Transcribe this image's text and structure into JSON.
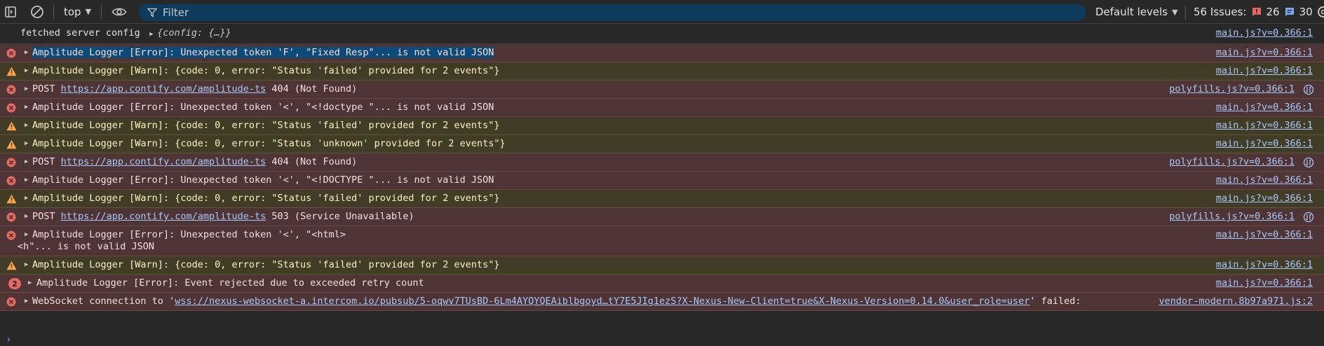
{
  "toolbar": {
    "context_label": "top",
    "filter_placeholder": "Filter",
    "levels_label": "Default levels",
    "issues_label": "56 Issues:",
    "issues_errors": "26",
    "issues_messages": "30"
  },
  "rows": [
    {
      "type": "info",
      "text": "fetched server config",
      "object": "{config: {…}}",
      "source": "main.js?v=0.366:1"
    },
    {
      "type": "error",
      "text": "Amplitude Logger [Error]: Unexpected token 'F', \"Fixed Resp\"... is not valid JSON",
      "source": "main.js?v=0.366:1"
    },
    {
      "type": "warn",
      "text": "Amplitude Logger [Warn]: {code: 0, error: \"Status 'failed' provided for 2 events\"}",
      "source": "main.js?v=0.366:1"
    },
    {
      "type": "error",
      "pre": "POST ",
      "link": "https://app.contify.com/amplitude-ts",
      "post": " 404 (Not Found)",
      "source": "polyfills.js?v=0.366:1"
    },
    {
      "type": "error",
      "text": "Amplitude Logger [Error]: Unexpected token '<', \"<!doctype \"... is not valid JSON",
      "source": "main.js?v=0.366:1"
    },
    {
      "type": "warn",
      "text": "Amplitude Logger [Warn]: {code: 0, error: \"Status 'failed' provided for 2 events\"}",
      "source": "main.js?v=0.366:1"
    },
    {
      "type": "warn",
      "text": "Amplitude Logger [Warn]: {code: 0, error: \"Status 'unknown' provided for 2 events\"}",
      "source": "main.js?v=0.366:1"
    },
    {
      "type": "error",
      "pre": "POST ",
      "link": "https://app.contify.com/amplitude-ts",
      "post": " 404 (Not Found)",
      "source": "polyfills.js?v=0.366:1"
    },
    {
      "type": "error",
      "text": "Amplitude Logger [Error]: Unexpected token '<', \"<!DOCTYPE \"... is not valid JSON",
      "source": "main.js?v=0.366:1"
    },
    {
      "type": "warn",
      "text": "Amplitude Logger [Warn]: {code: 0, error: \"Status 'failed' provided for 2 events\"}",
      "source": "main.js?v=0.366:1"
    },
    {
      "type": "error",
      "pre": "POST ",
      "link": "https://app.contify.com/amplitude-ts",
      "post": " 503 (Service Unavailable)",
      "source": "polyfills.js?v=0.366:1"
    },
    {
      "type": "error",
      "text": "Amplitude Logger [Error]: Unexpected token '<', \"<html>",
      "line2": "<h\"... is not valid JSON",
      "source": "main.js?v=0.366:1"
    },
    {
      "type": "warn",
      "text": "Amplitude Logger [Warn]: {code: 0, error: \"Status 'failed' provided for 2 events\"}",
      "source": "main.js?v=0.366:1"
    },
    {
      "type": "error",
      "count": "2",
      "text": "Amplitude Logger [Error]: Event rejected due to exceeded retry count",
      "source": "main.js?v=0.366:1"
    },
    {
      "type": "error",
      "pre": "WebSocket connection to '",
      "link": "wss://nexus-websocket-a.intercom.io/pubsub/5-oqwv7TUsBD-6Lm4AYQYQEAiblbgoyd…tY7E5JIg1ezS?X-Nexus-New-Client=true&X-Nexus-Version=0.14.0&user_role=user",
      "post": "' failed:",
      "source": "vendor-modern.8b97a971.js:2"
    }
  ],
  "colors": {
    "error_bg": "#4e3434",
    "warn_bg": "#413c26",
    "link": "#a8c7fa",
    "filter_bg": "#0e3a5c"
  }
}
